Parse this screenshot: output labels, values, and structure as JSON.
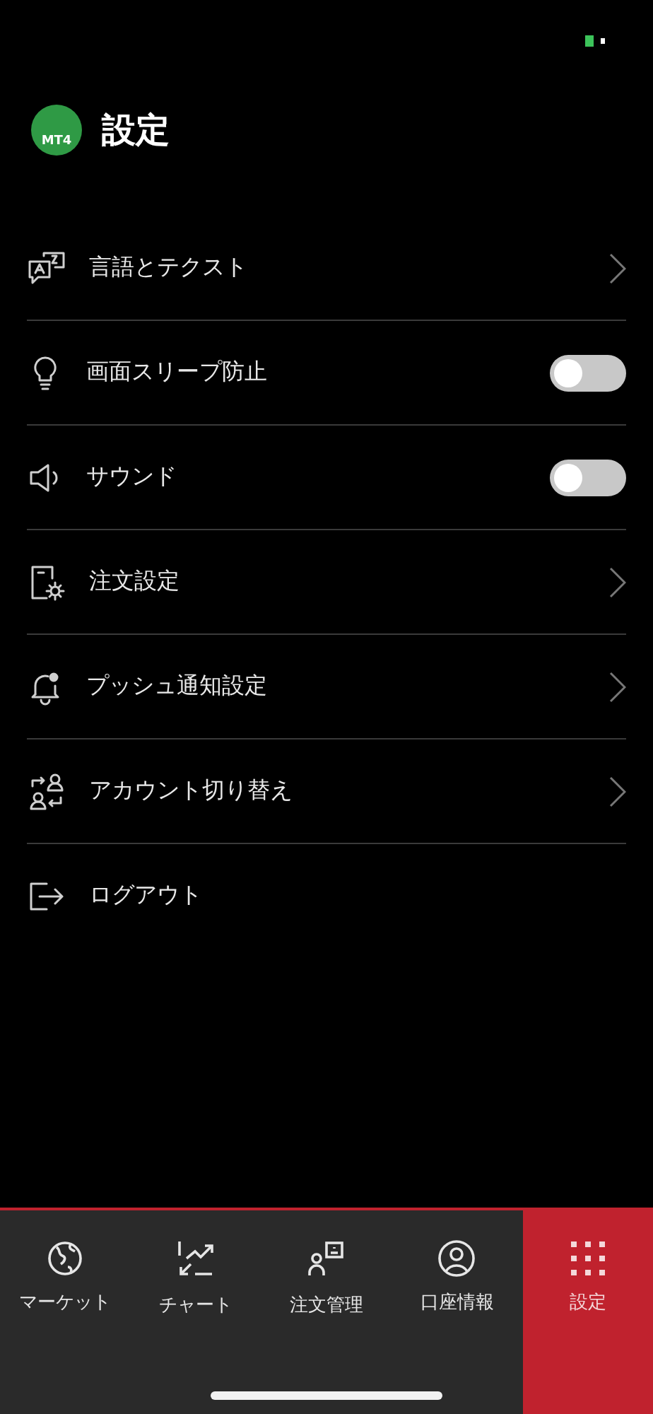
{
  "header": {
    "logo_text": "MT4",
    "title": "設定"
  },
  "settings": [
    {
      "kind": "link",
      "label": "言語とテクスト"
    },
    {
      "kind": "toggle",
      "label": "画面スリープ防止",
      "on": false
    },
    {
      "kind": "toggle",
      "label": "サウンド",
      "on": false
    },
    {
      "kind": "link",
      "label": "注文設定"
    },
    {
      "kind": "link",
      "label": "プッシュ通知設定"
    },
    {
      "kind": "link",
      "label": "アカウント切り替え"
    },
    {
      "kind": "action",
      "label": "ログアウト"
    }
  ],
  "tab_bar": [
    {
      "label": "マーケット",
      "selected": false
    },
    {
      "label": "チャート",
      "selected": false
    },
    {
      "label": "注文管理",
      "selected": false
    },
    {
      "label": "口座情報",
      "selected": false
    },
    {
      "label": "設定",
      "selected": true
    }
  ]
}
